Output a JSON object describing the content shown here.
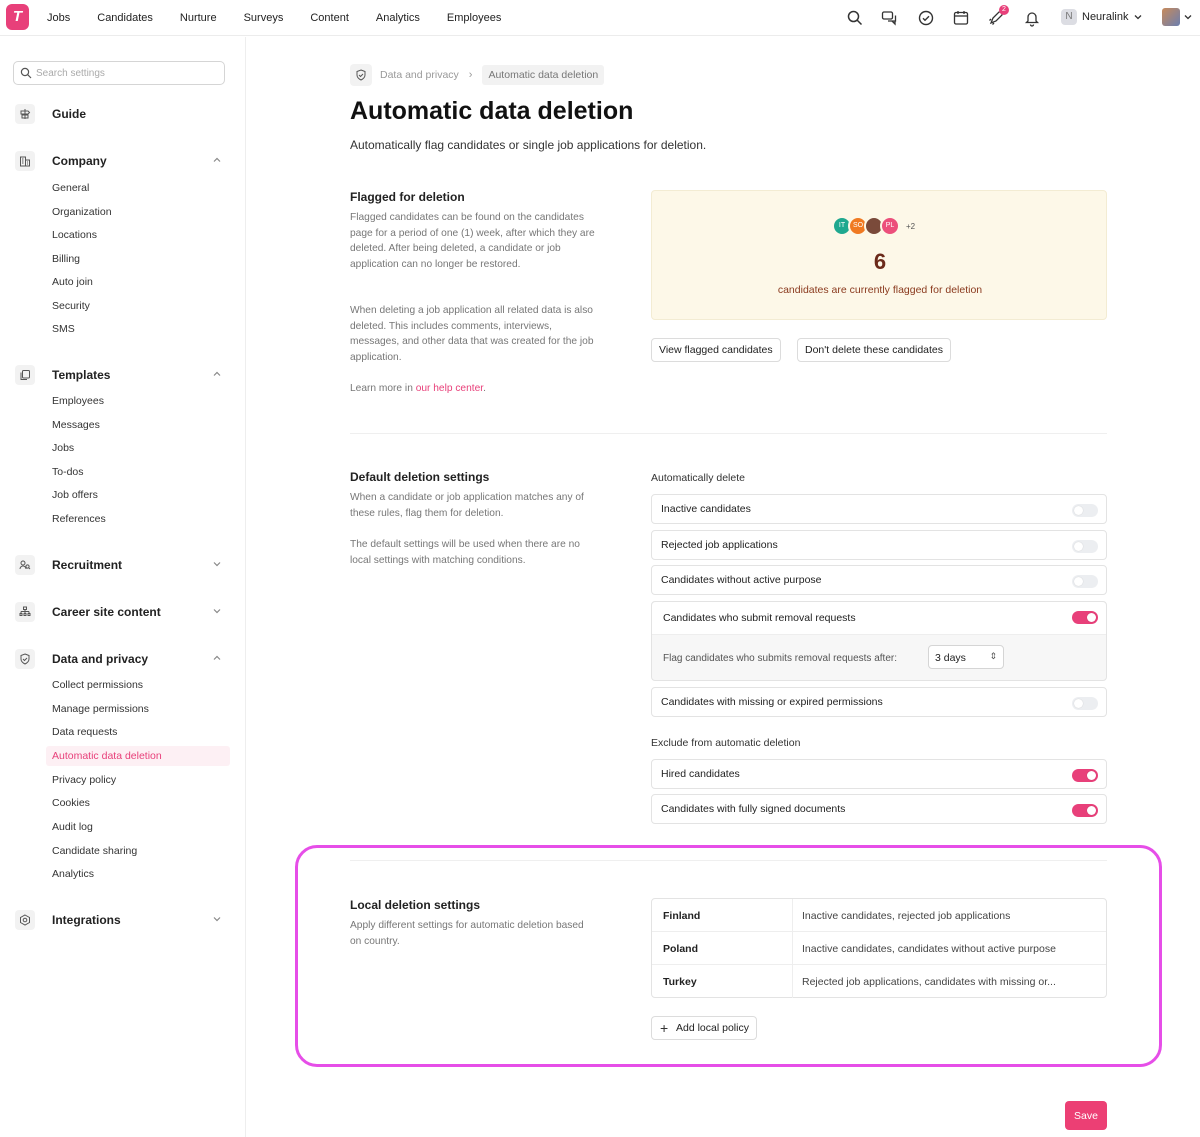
{
  "nav": {
    "logo": "T",
    "links": [
      "Jobs",
      "Candidates",
      "Nurture",
      "Surveys",
      "Content",
      "Analytics",
      "Employees"
    ],
    "notification_count": "2",
    "company_initial": "N",
    "company_name": "Neuralink"
  },
  "sidebar": {
    "search_placeholder": "Search settings",
    "guide": "Guide",
    "company": {
      "title": "Company",
      "items": [
        "General",
        "Organization",
        "Locations",
        "Billing",
        "Auto join",
        "Security",
        "SMS"
      ]
    },
    "templates": {
      "title": "Templates",
      "items": [
        "Employees",
        "Messages",
        "Jobs",
        "To-dos",
        "Job offers",
        "References"
      ]
    },
    "recruitment": "Recruitment",
    "career_site": "Career site content",
    "data_privacy": {
      "title": "Data and privacy",
      "items": [
        "Collect permissions",
        "Manage permissions",
        "Data requests",
        "Automatic data deletion",
        "Privacy policy",
        "Cookies",
        "Audit log",
        "Candidate sharing",
        "Analytics"
      ]
    },
    "integrations": "Integrations"
  },
  "breadcrumb": {
    "parent": "Data and privacy",
    "current": "Automatic data deletion"
  },
  "page": {
    "title": "Automatic data deletion",
    "subtitle": "Automatically flag candidates or single job applications for deletion."
  },
  "flagged": {
    "title": "Flagged for deletion",
    "p1": "Flagged candidates can be found on the candidates page for a period of one (1) week, after which they are deleted. After being deleted, a candidate or job application can no longer be restored.",
    "p2": "When deleting a job application all related data is also deleted. This includes comments, interviews, messages, and other data that was created for the job application.",
    "learn_prefix": "Learn more in ",
    "learn_link": "our help center",
    "learn_suffix": ".",
    "avatars": [
      "IT",
      "SO",
      "",
      "PL"
    ],
    "more": "+2",
    "count": "6",
    "count_text": "candidates are currently flagged for deletion",
    "btn_view": "View flagged candidates",
    "btn_dont": "Don't delete these candidates"
  },
  "defaults": {
    "title": "Default deletion settings",
    "p1": "When a candidate or job application matches any of these rules, flag them for deletion.",
    "p2": "The default settings will be used when there are no local settings with matching conditions.",
    "auto_label": "Automatically delete",
    "inactive": "Inactive candidates",
    "rejected": "Rejected job applications",
    "no_purpose": "Candidates without active purpose",
    "removal": "Candidates who submit removal requests",
    "removal_sub": "Flag candidates who submits removal requests after:",
    "removal_value": "3 days",
    "missing": "Candidates with missing or expired permissions",
    "exclude_label": "Exclude from automatic deletion",
    "hired": "Hired candidates",
    "signed": "Candidates with fully signed documents"
  },
  "local": {
    "title": "Local deletion settings",
    "desc": "Apply different settings for automatic deletion based on country.",
    "rows": [
      {
        "country": "Finland",
        "desc": "Inactive candidates, rejected job applications"
      },
      {
        "country": "Poland",
        "desc": "Inactive candidates, candidates without active purpose"
      },
      {
        "country": "Turkey",
        "desc": "Rejected job applications, candidates with missing or..."
      }
    ],
    "add": "Add local policy"
  },
  "save": "Save",
  "colors": {
    "accent": "#e8407a",
    "highlight": "#e64ee8",
    "flag_bg": "#fdf8e8"
  }
}
